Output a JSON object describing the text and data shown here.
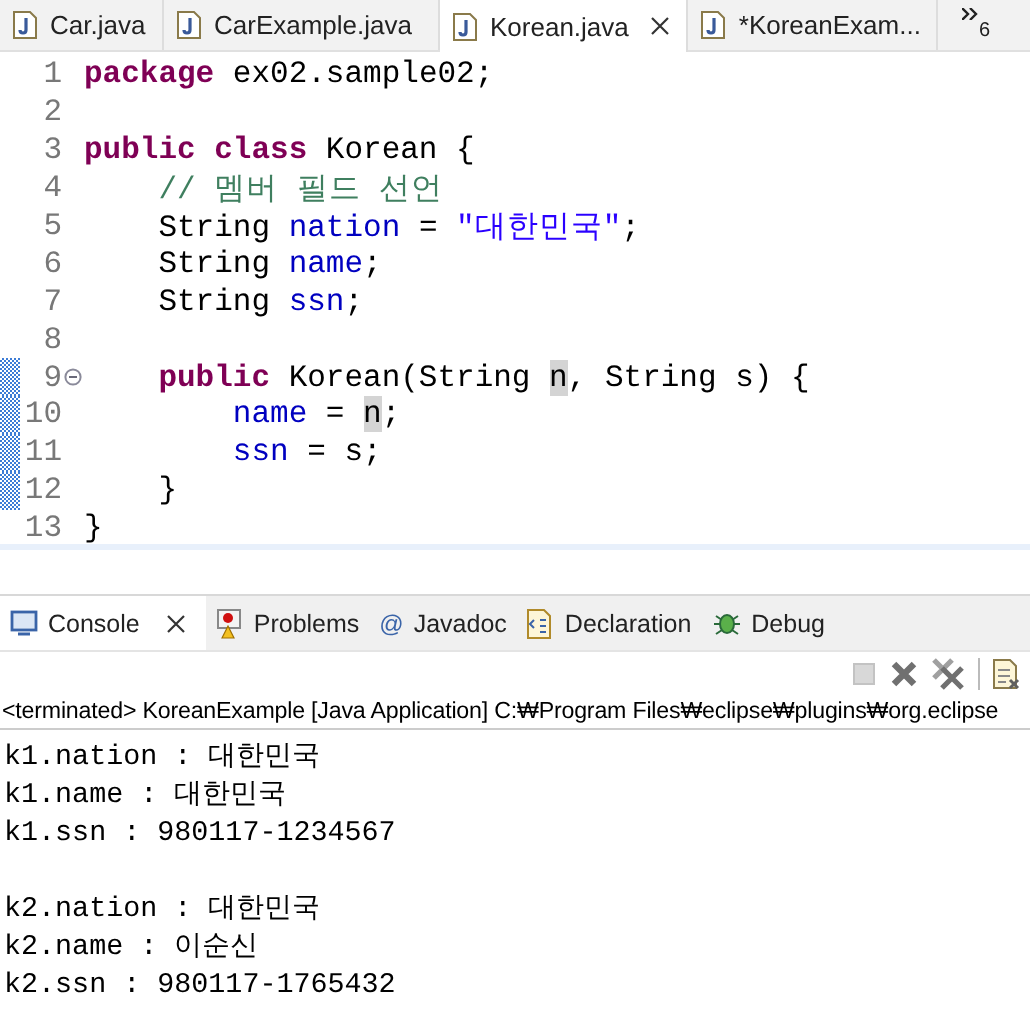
{
  "editor_tabs": [
    {
      "label": "Car.java",
      "selected": false,
      "closable": false
    },
    {
      "label": "CarExample.java",
      "selected": false,
      "closable": false
    },
    {
      "label": "Korean.java",
      "selected": true,
      "closable": true
    },
    {
      "label": "*KoreanExam...",
      "selected": false,
      "closable": false
    }
  ],
  "overflow_count": "6",
  "code_lines": [
    {
      "number": "1",
      "fold": false,
      "marked": false,
      "tokens": [
        {
          "kind": "keyword",
          "text": "package"
        },
        {
          "kind": "plain",
          "text": " ex02.sample02;"
        }
      ]
    },
    {
      "number": "2",
      "fold": false,
      "marked": false
    },
    {
      "number": "3",
      "fold": false,
      "marked": false,
      "tokens": [
        {
          "kind": "keyword",
          "text": "public class"
        },
        {
          "kind": "plain",
          "text": " Korean {"
        }
      ]
    },
    {
      "number": "4",
      "fold": false,
      "marked": false,
      "tokens": [
        {
          "kind": "comment",
          "text": "    // 멤버 필드 선언"
        }
      ]
    },
    {
      "number": "5",
      "fold": false,
      "marked": false,
      "tokens": [
        {
          "kind": "plain",
          "text": "    String "
        },
        {
          "kind": "field",
          "text": "nation"
        },
        {
          "kind": "plain",
          "text": " = "
        },
        {
          "kind": "string",
          "text": "\"대한민국\""
        },
        {
          "kind": "plain",
          "text": ";"
        }
      ]
    },
    {
      "number": "6",
      "fold": false,
      "marked": false,
      "tokens": [
        {
          "kind": "plain",
          "text": "    String "
        },
        {
          "kind": "field",
          "text": "name"
        },
        {
          "kind": "plain",
          "text": ";"
        }
      ]
    },
    {
      "number": "7",
      "fold": false,
      "marked": false,
      "tokens": [
        {
          "kind": "plain",
          "text": "    String "
        },
        {
          "kind": "field",
          "text": "ssn"
        },
        {
          "kind": "plain",
          "text": ";"
        }
      ]
    },
    {
      "number": "8",
      "fold": false,
      "marked": false
    },
    {
      "number": "9",
      "fold": true,
      "marked": true,
      "tokens": [
        {
          "kind": "keyword",
          "text": "    public"
        },
        {
          "kind": "plain",
          "text": " Korean(String "
        },
        {
          "kind": "occurrence",
          "text": "n"
        },
        {
          "kind": "plain",
          "text": ", String s) {"
        }
      ]
    },
    {
      "number": "10",
      "fold": false,
      "marked": true,
      "tokens": [
        {
          "kind": "field",
          "text": "        name"
        },
        {
          "kind": "plain",
          "text": " = "
        },
        {
          "kind": "occurrence",
          "text": "n"
        },
        {
          "kind": "plain",
          "text": ";"
        }
      ]
    },
    {
      "number": "11",
      "fold": false,
      "marked": true,
      "tokens": [
        {
          "kind": "field",
          "text": "        ssn"
        },
        {
          "kind": "plain",
          "text": " = s;"
        }
      ]
    },
    {
      "number": "12",
      "fold": false,
      "marked": true,
      "tokens": [
        {
          "kind": "plain",
          "text": "    }"
        }
      ]
    },
    {
      "number": "13",
      "fold": false,
      "marked": false,
      "tokens": [
        {
          "kind": "plain",
          "text": "}"
        }
      ]
    }
  ],
  "view_tabs": [
    {
      "label": "Console",
      "kind": "console",
      "selected": true,
      "closable": true
    },
    {
      "label": "Problems",
      "kind": "problems",
      "selected": false,
      "closable": false
    },
    {
      "label": "Javadoc",
      "kind": "javadoc",
      "selected": false,
      "closable": false,
      "icon_text": "@"
    },
    {
      "label": "Declaration",
      "kind": "declaration",
      "selected": false,
      "closable": false
    },
    {
      "label": "Debug",
      "kind": "debug",
      "selected": false,
      "closable": false
    }
  ],
  "console_toolbar": [
    {
      "kind": "terminate",
      "disabled": true
    },
    {
      "kind": "remove",
      "disabled": false
    },
    {
      "kind": "remove-all",
      "disabled": false
    },
    {
      "kind": "separator"
    },
    {
      "kind": "clear",
      "disabled": false
    }
  ],
  "console_header": "<terminated> KoreanExample [Java Application] C:₩Program Files₩eclipse₩plugins₩org.eclipse",
  "console_output": [
    [
      "k1.nation : 대한민국",
      "k1.name : 대한민국",
      "k1.ssn : 980117-1234567"
    ],
    [
      "k2.nation : 대한민국",
      "k2.name : 이순신",
      "k2.ssn : 980117-1765432"
    ]
  ]
}
